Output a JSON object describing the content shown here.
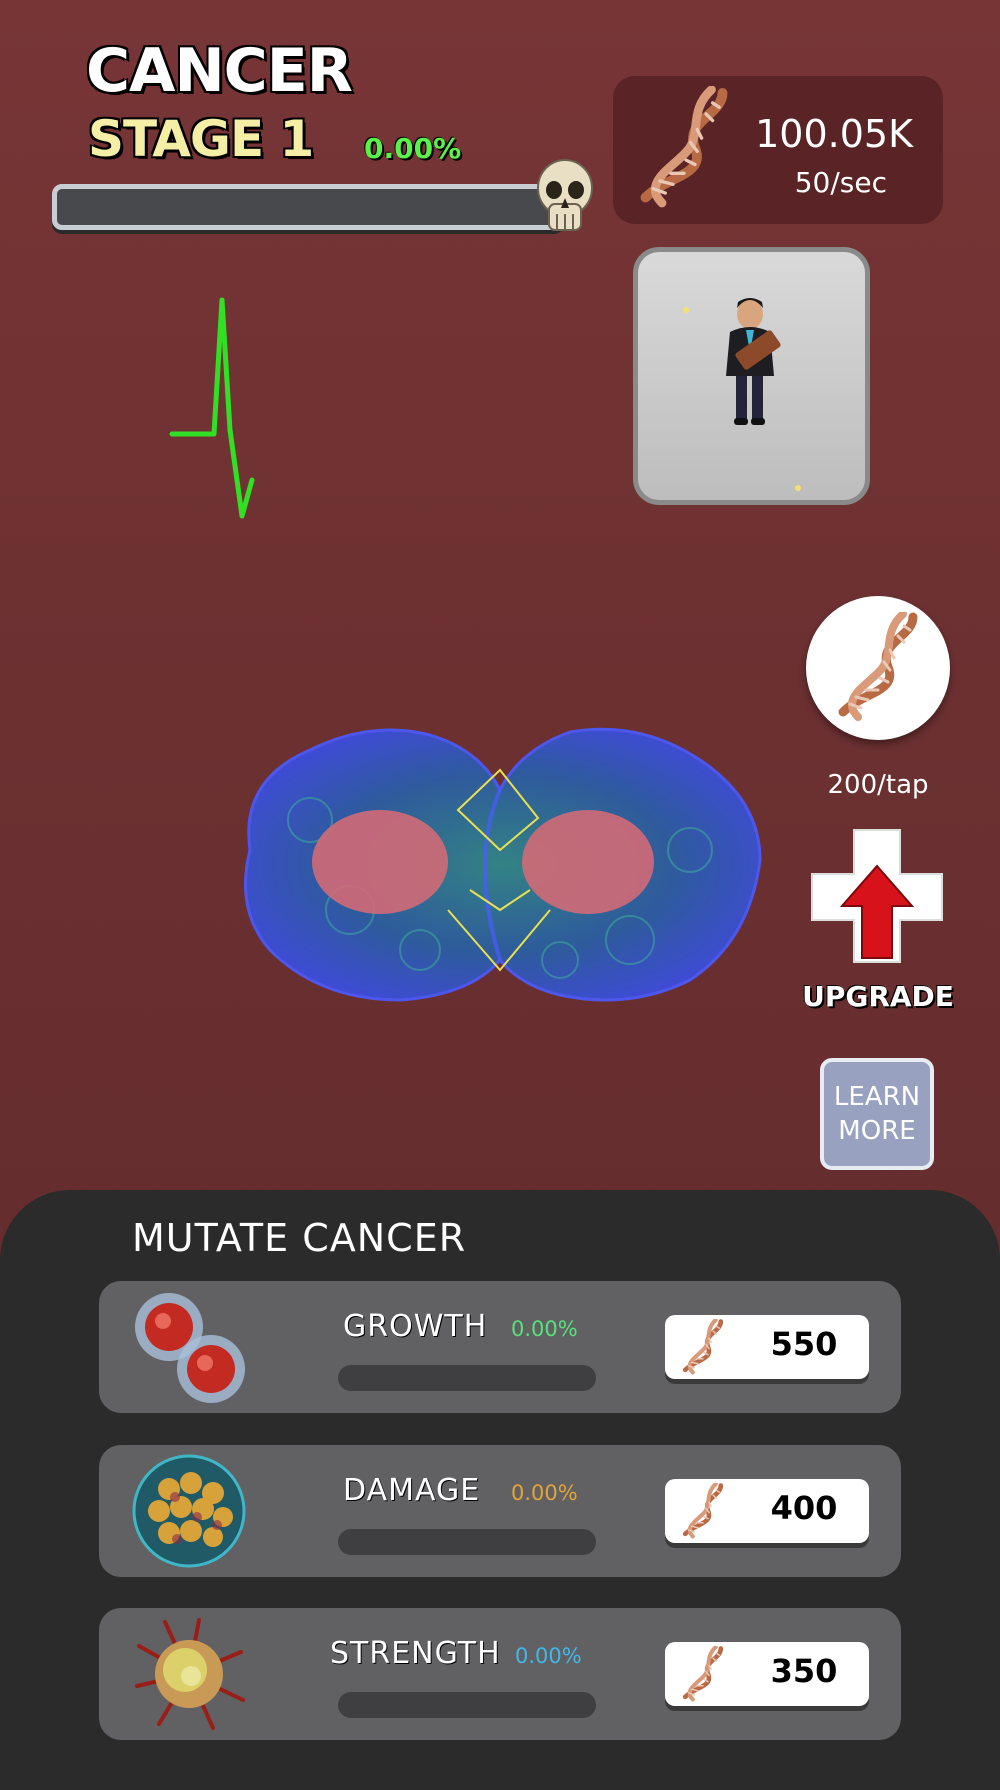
{
  "header": {
    "title": "CANCER",
    "stage": "STAGE 1",
    "stage_progress_label": "0.00%",
    "stage_progress": 0.0
  },
  "currency": {
    "amount": "100.05K",
    "rate": "50/sec",
    "icon": "dna-icon"
  },
  "tap": {
    "rate": "200/tap",
    "icon": "dna-icon"
  },
  "upgrade": {
    "label": "UPGRADE",
    "icon": "medical-cross-arrow-icon"
  },
  "learn_more": {
    "label": "LEARN MORE"
  },
  "mutate": {
    "title": "MUTATE CANCER",
    "items": [
      {
        "name": "GROWTH",
        "pct": "0.00%",
        "progress": 0.0,
        "cost": "550",
        "pct_color": "#59e07a",
        "icon": "dividing-cell-icon"
      },
      {
        "name": "DAMAGE",
        "pct": "0.00%",
        "progress": 0.0,
        "cost": "400",
        "pct_color": "#e0a43a",
        "icon": "cell-cluster-icon"
      },
      {
        "name": "STRENGTH",
        "pct": "0.00%",
        "progress": 0.0,
        "cost": "350",
        "pct_color": "#42b8e8",
        "icon": "tumor-cell-icon"
      }
    ]
  },
  "colors": {
    "background": "#6c3031",
    "panel": "#2b2b2b",
    "progress_green": "#59f24b"
  }
}
